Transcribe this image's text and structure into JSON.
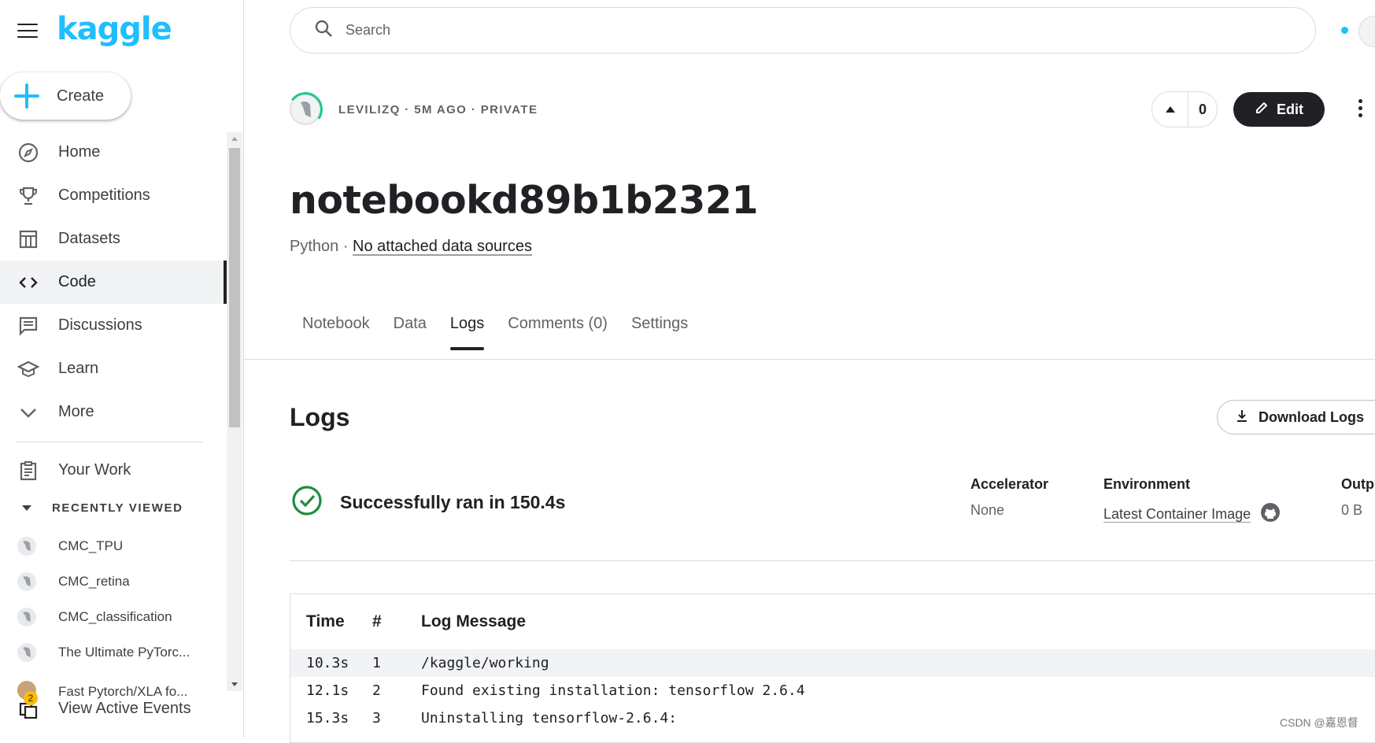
{
  "sidebar": {
    "logo": "kaggle",
    "create_label": "Create",
    "nav": [
      {
        "label": "Home",
        "icon": "compass-icon"
      },
      {
        "label": "Competitions",
        "icon": "trophy-icon"
      },
      {
        "label": "Datasets",
        "icon": "table-icon"
      },
      {
        "label": "Code",
        "icon": "code-icon",
        "active": true
      },
      {
        "label": "Discussions",
        "icon": "comments-icon"
      },
      {
        "label": "Learn",
        "icon": "school-icon"
      },
      {
        "label": "More",
        "icon": "chevron-down-icon"
      }
    ],
    "your_work": "Your Work",
    "recently_viewed": "RECENTLY VIEWED",
    "recent_items": [
      "CMC_TPU",
      "CMC_retina",
      "CMC_classification",
      "The Ultimate PyTorc...",
      "Fast Pytorch/XLA fo..."
    ],
    "active_events": "View Active Events",
    "active_events_badge": "2"
  },
  "search": {
    "placeholder": "Search"
  },
  "notebook": {
    "meta": "LEVILIZQ · 5M AGO · PRIVATE",
    "votes": "0",
    "edit_label": "Edit",
    "title": "notebookd89b1b2321",
    "language": "Python",
    "language_sep": " · ",
    "data_sources": "No attached data sources"
  },
  "tabs": [
    "Notebook",
    "Data",
    "Logs",
    "Comments (0)",
    "Settings"
  ],
  "active_tab": "Logs",
  "logs": {
    "heading": "Logs",
    "download_label": "Download Logs",
    "status": "Successfully ran in 150.4s",
    "accelerator_label": "Accelerator",
    "accelerator_value": "None",
    "environment_label": "Environment",
    "environment_value": "Latest Container Image",
    "output_label": "Outp",
    "output_value": "0 B",
    "columns": [
      "Time",
      "#",
      "Log Message"
    ],
    "rows": [
      {
        "time": "10.3s",
        "num": "1",
        "msg": "/kaggle/working"
      },
      {
        "time": "12.1s",
        "num": "2",
        "msg": "Found existing installation: tensorflow 2.6.4"
      },
      {
        "time": "15.3s",
        "num": "3",
        "msg": "Uninstalling tensorflow-2.6.4:"
      }
    ]
  },
  "watermark": "CSDN @嘉恩督",
  "colors": {
    "brand": "#20beff",
    "success": "#1e8e3e",
    "dark": "#202124"
  }
}
